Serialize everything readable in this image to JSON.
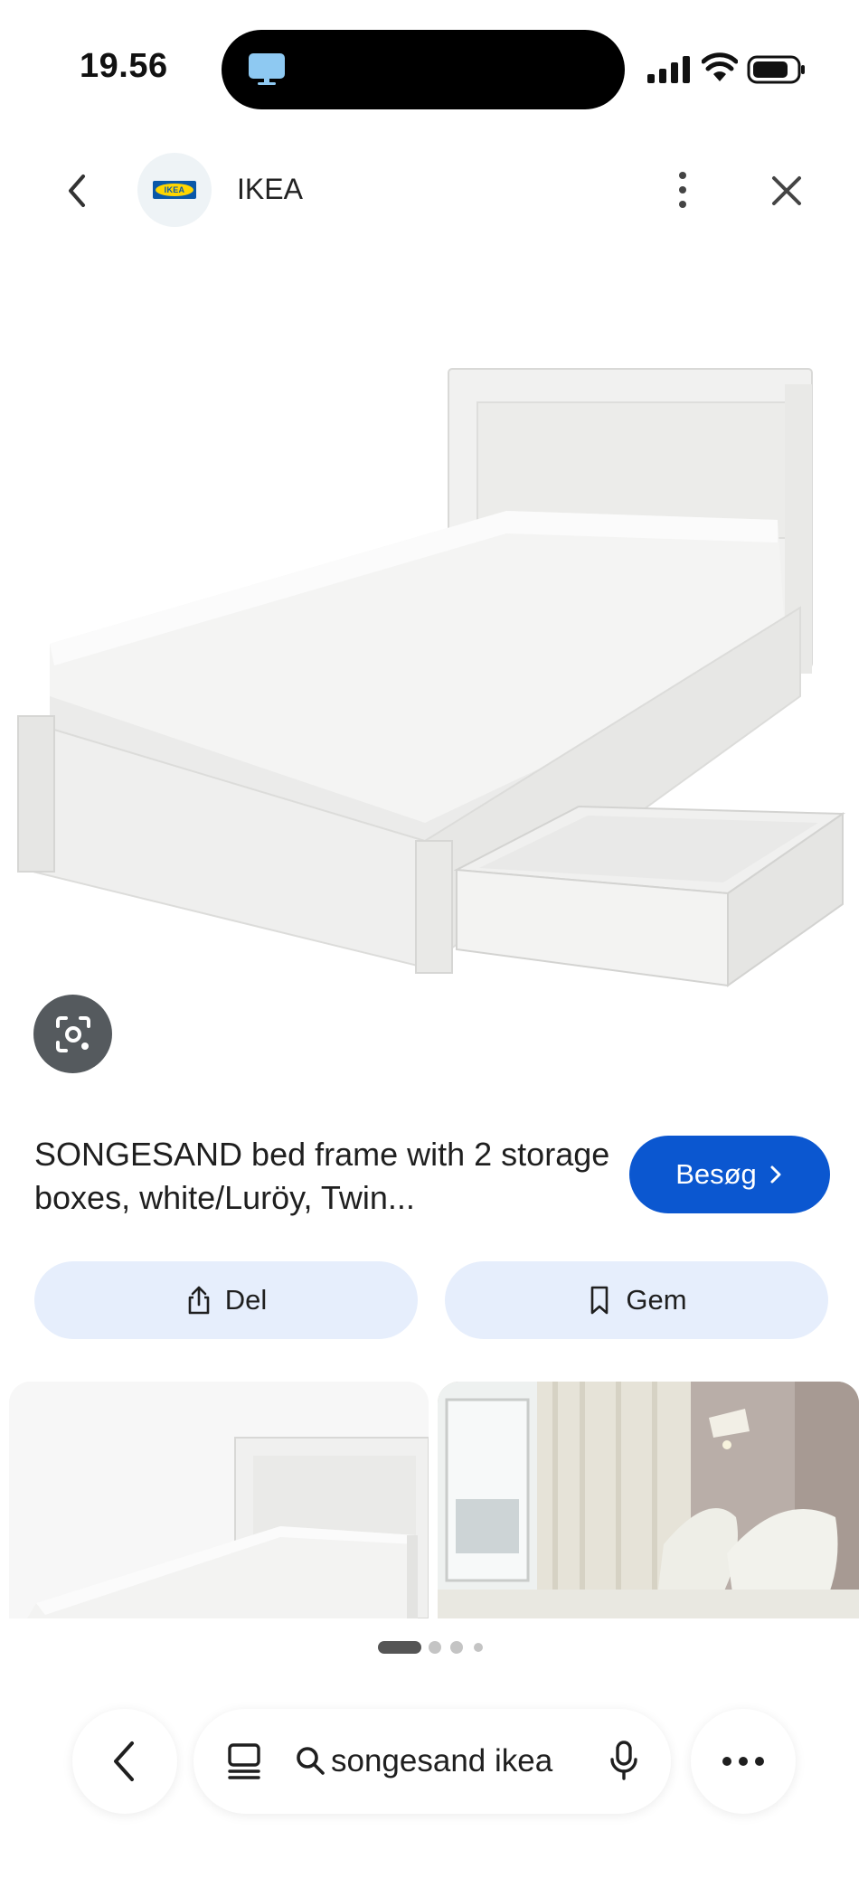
{
  "status_bar": {
    "time": "19.56",
    "icons": [
      "tv-icon",
      "signal-icon",
      "wifi-icon",
      "battery-icon"
    ]
  },
  "header": {
    "site_name": "IKEA",
    "logo_text": "IKEA",
    "icons": [
      "back-arrow-icon",
      "more-vertical-icon",
      "close-icon"
    ]
  },
  "product": {
    "title": "SONGESAND bed frame with 2 storage boxes, white/Luröy, Twin...",
    "visit_label": "Besøg"
  },
  "actions": {
    "share_label": "Del",
    "save_label": "Gem"
  },
  "pager": {
    "count": 4,
    "active_index": 0
  },
  "bottom_bar": {
    "query": "songesand ikea",
    "icons": [
      "back-chevron-icon",
      "tabs-icon",
      "search-icon",
      "mic-icon",
      "more-horizontal-icon"
    ]
  },
  "colors": {
    "accent": "#0b57d0",
    "chip_background": "#e6eefc",
    "lens_button": "#555a5e"
  }
}
